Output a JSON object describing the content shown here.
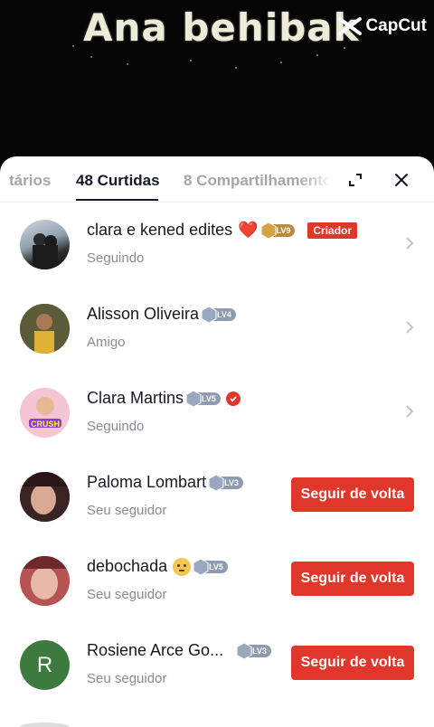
{
  "video": {
    "title": "Ana behibak",
    "watermark": "CapCut"
  },
  "tabs": [
    {
      "label": "tários",
      "active": false
    },
    {
      "label": "48 Curtidas",
      "active": true
    },
    {
      "label": "8 Compartilhamento",
      "active": false
    }
  ],
  "toolbar": {
    "expand_icon": "expand-icon",
    "close_icon": "close-icon"
  },
  "users": [
    {
      "name": "clara e kened edites",
      "level": "LV9",
      "badge": "Criador",
      "status": "Seguindo",
      "heart": "❤️",
      "action": "chevron"
    },
    {
      "name": "Alisson Oliveira",
      "level": "LV4",
      "status": "Amigo",
      "action": "chevron"
    },
    {
      "name": "Clara Martins",
      "level": "LV5",
      "status": "Seguindo",
      "verified": true,
      "action": "chevron"
    },
    {
      "name": "Paloma Lombart",
      "level": "LV3",
      "status": "Seu seguidor",
      "action": "Seguir de volta"
    },
    {
      "name": "debochada",
      "level": "LV5",
      "status": "Seu seguidor",
      "emoji": "face-emoji",
      "action": "Seguir de volta"
    },
    {
      "name": "Rosiene Arce Go...",
      "level": "LV3",
      "status": "Seu seguidor",
      "avatar_letter": "R",
      "action": "Seguir de volta"
    }
  ],
  "colors": {
    "accent": "#e1372a",
    "avatar_green": "#3d7a3e"
  }
}
